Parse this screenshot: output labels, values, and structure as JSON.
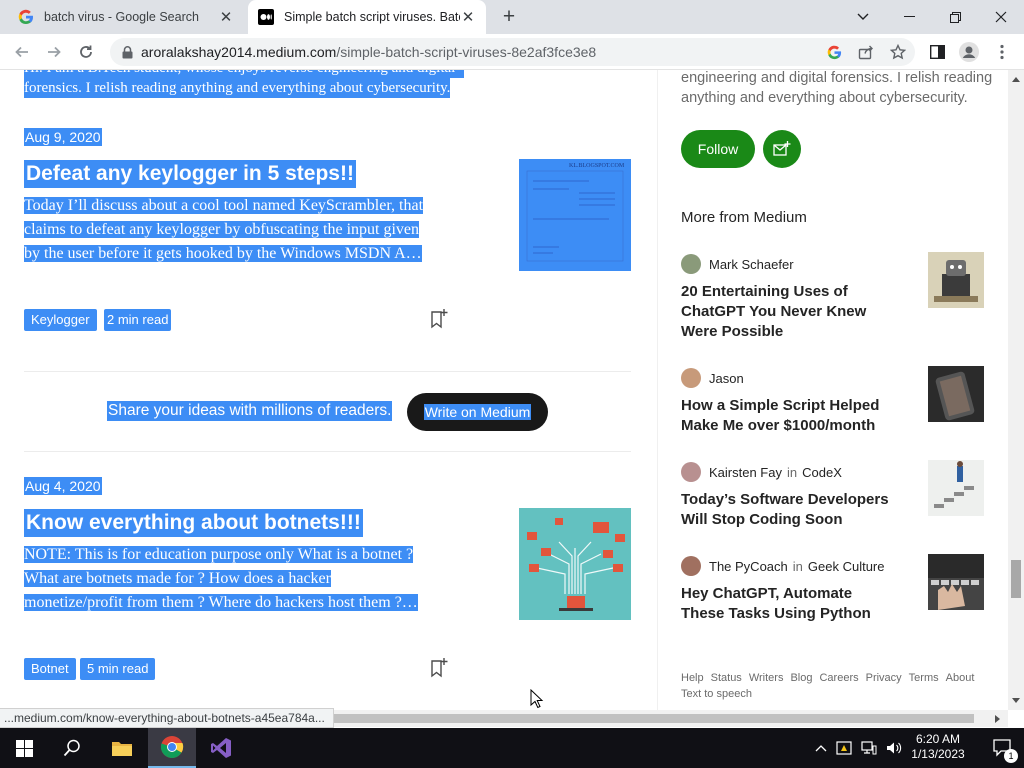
{
  "browser": {
    "tabs": [
      {
        "title": "batch virus - Google Search",
        "favicon": "google-g-icon"
      },
      {
        "title": "Simple batch script viruses. Batch",
        "favicon": "medium-icon"
      }
    ],
    "url_domain": "aroralakshay2014.medium.com",
    "url_path": "/simple-batch-script-viruses-8e2af3fce3e8",
    "status_url": "...medium.com/know-everything-about-botnets-a45ea784a..."
  },
  "page": {
    "bio_partial": [
      "Hi. I am a B.Tech student, whose enjoys reverse engineering and digital",
      "forensics. I relish reading anything and everything about cybersecurity."
    ],
    "posts": [
      {
        "date": "Aug 9, 2020",
        "title": "Defeat any keylogger in 5 steps!!",
        "excerpt": [
          "Today I’ll discuss about a cool tool named KeyScrambler, that",
          "claims to defeat any keylogger by obfuscating the input given",
          "by the user before it gets hooked by the Windows MSDN A…"
        ],
        "tag": "Keylogger",
        "read_time": "2 min read",
        "thumb_text": "KL.BLOGSPOT.COM"
      },
      {
        "date": "Aug 4, 2020",
        "title": "Know everything about botnets!!!",
        "excerpt": [
          "NOTE: This is for education purpose only What is a botnet ?",
          "What are botnets made for ? How does a hacker",
          "monetize/profit from them ? Where do hackers host them ?…"
        ],
        "tag": "Botnet",
        "read_time": "5 min read"
      }
    ],
    "cta": {
      "text": "Share your ideas with millions of readers.",
      "button": "Write on Medium"
    }
  },
  "sidebar": {
    "bio_partial": [
      "engineering and digital forensics. I relish reading",
      "anything and everything about cybersecurity."
    ],
    "follow": "Follow",
    "more_heading": "More from Medium",
    "stories": [
      {
        "author": "Mark Schaefer",
        "pub": "",
        "title": "20 Entertaining Uses of ChatGPT You Never Knew Were Possible"
      },
      {
        "author": "Jason",
        "pub": "",
        "title": "How a Simple Script Helped Make Me over $1000/month"
      },
      {
        "author": "Kairsten Fay",
        "in": "in",
        "pub": "CodeX",
        "title": "Today’s Software Developers Will Stop Coding Soon"
      },
      {
        "author": "The PyCoach",
        "in": "in",
        "pub": "Geek Culture",
        "title": "Hey ChatGPT, Automate These Tasks Using Python"
      }
    ],
    "footer": [
      "Help",
      "Status",
      "Writers",
      "Blog",
      "Careers",
      "Privacy",
      "Terms",
      "About",
      "Text to speech"
    ]
  },
  "taskbar": {
    "time": "6:20 AM",
    "date": "1/13/2023",
    "notification_count": "1"
  },
  "colors": {
    "selection": "#3d8df5",
    "follow_green": "#1a8917",
    "tab_strip": "#dee1e6"
  }
}
